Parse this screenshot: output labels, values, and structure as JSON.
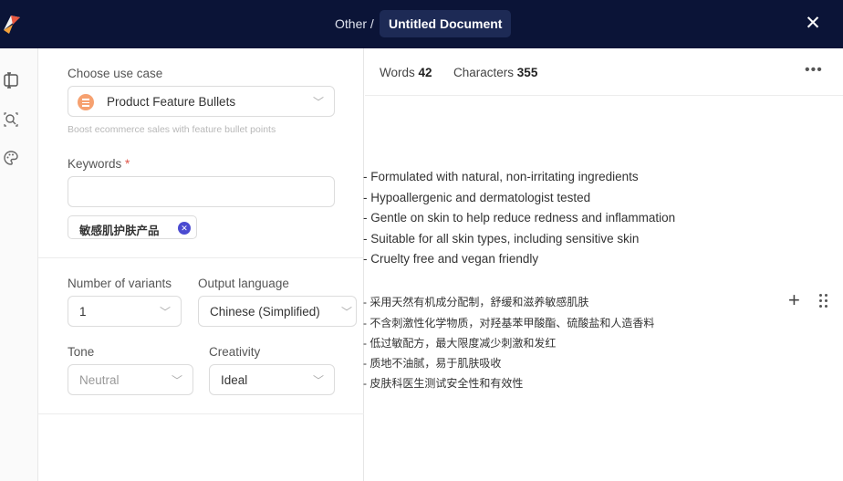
{
  "header": {
    "breadcrumb": "Other /",
    "doc_title": "Untitled Document"
  },
  "form": {
    "use_case": {
      "label": "Choose use case",
      "value": "Product Feature Bullets",
      "hint": "Boost ecommerce sales with feature bullet points"
    },
    "keywords": {
      "label": "Keywords",
      "required_mark": "*",
      "value": "",
      "tags": [
        "敏感肌护肤产品"
      ]
    },
    "variants": {
      "label": "Number of variants",
      "value": "1"
    },
    "language": {
      "label": "Output language",
      "value": "Chinese (Simplified)"
    },
    "tone": {
      "label": "Tone",
      "value": "Neutral"
    },
    "creativity": {
      "label": "Creativity",
      "value": "Ideal"
    }
  },
  "editor": {
    "words_label": "Words",
    "words": "42",
    "chars_label": "Characters",
    "chars": "355",
    "lines_en": [
      "- Formulated with natural, non-irritating ingredients",
      "- Hypoallergenic and dermatologist tested",
      "- Gentle on skin to help reduce redness and inflammation",
      "- Suitable for all skin types, including sensitive skin",
      "- Cruelty free and vegan friendly"
    ],
    "lines_zh": [
      "- 采用天然有机成分配制，舒缓和滋养敏感肌肤",
      "- 不含刺激性化学物质，对羟基苯甲酸酯、硫酸盐和人造香料",
      "- 低过敏配方，最大限度减少刺激和发红",
      "- 质地不油腻，易于肌肤吸收",
      "- 皮肤科医生测试安全性和有效性"
    ]
  },
  "colors": {
    "header_bg": "#0b1437",
    "accent": "#4b4bd1",
    "use_case_icon": "#f6a170"
  }
}
